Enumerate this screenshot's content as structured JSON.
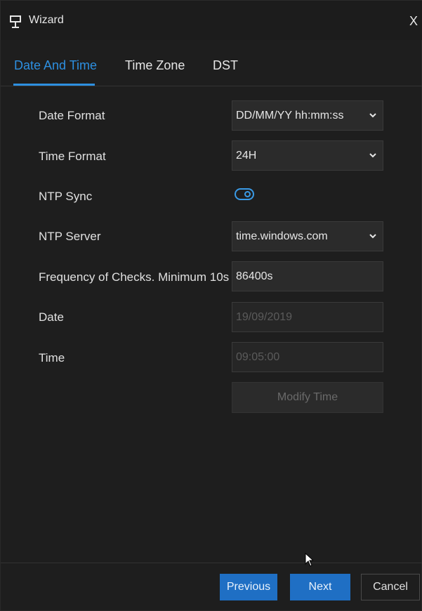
{
  "window": {
    "title": "Wizard",
    "close_label": "X"
  },
  "tabs": [
    {
      "label": "Date And Time",
      "active": true
    },
    {
      "label": "Time Zone",
      "active": false
    },
    {
      "label": "DST",
      "active": false
    }
  ],
  "form": {
    "date_format": {
      "label": "Date Format",
      "value": "DD/MM/YY hh:mm:ss"
    },
    "time_format": {
      "label": "Time Format",
      "value": "24H"
    },
    "ntp_sync": {
      "label": "NTP Sync",
      "enabled": true
    },
    "ntp_server": {
      "label": "NTP Server",
      "value": "time.windows.com"
    },
    "frequency": {
      "label": "Frequency of Checks. Minimum 10s",
      "value": "86400s"
    },
    "date": {
      "label": "Date",
      "value": "19/09/2019"
    },
    "time": {
      "label": "Time",
      "value": "09:05:00"
    },
    "modify_time_label": "Modify Time"
  },
  "footer": {
    "previous": "Previous",
    "next": "Next",
    "cancel": "Cancel"
  },
  "colors": {
    "accent": "#2d8fe0",
    "button": "#1f6fc4",
    "background": "#1e1e1e"
  },
  "icons": {
    "title": "monitor-stand-icon",
    "close": "close-icon",
    "dropdown": "chevron-down-icon",
    "cursor": "mouse-pointer-icon"
  }
}
